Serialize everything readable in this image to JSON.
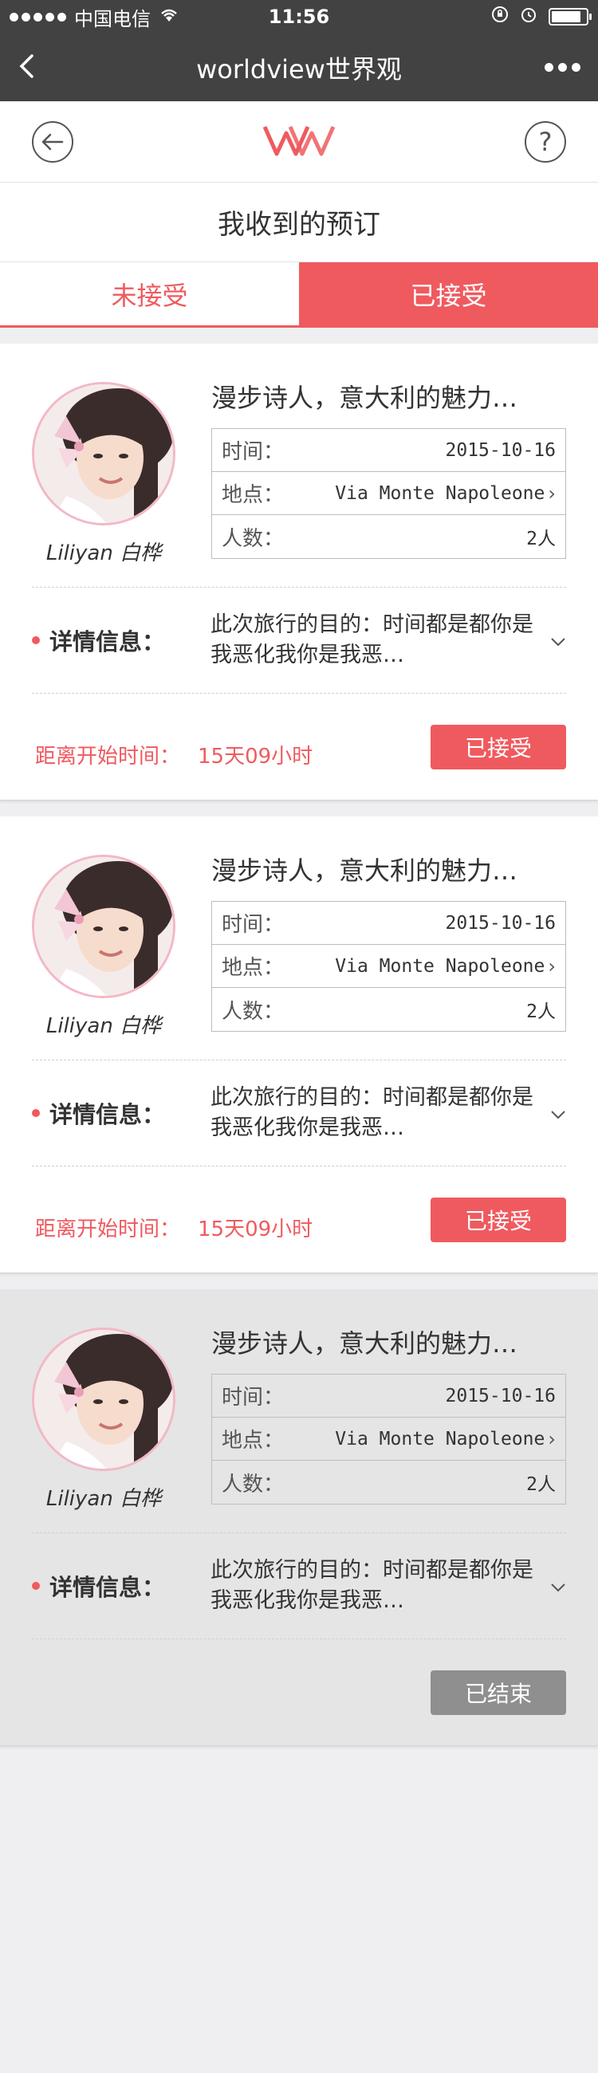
{
  "status_bar": {
    "carrier": "中国电信",
    "time": "11:56"
  },
  "nav": {
    "title": "worldview世界观"
  },
  "app_header": {
    "logo_text": "WV",
    "help_label": "?"
  },
  "section_title": "我收到的预订",
  "tabs": [
    {
      "label": "未接受",
      "active": false
    },
    {
      "label": "已接受",
      "active": true
    }
  ],
  "colors": {
    "accent": "#ef5a5f",
    "dark_bar": "#424242",
    "ended_bg": "#e5e5e5",
    "ended_button": "#8f8f8f"
  },
  "labels": {
    "time": "时间：",
    "place": "地点：",
    "people": "人数：",
    "detail": "详情信息：",
    "countdown": "距离开始时间："
  },
  "bookings": [
    {
      "host": "Liliyan 白桦",
      "title": "漫步诗人，意大利的魅力…",
      "date": "2015-10-16",
      "place": "Via Monte Napoleone",
      "people": "2人",
      "detail": "此次旅行的目的：时间都是都你是我恶化我你是我恶…",
      "countdown": "15天09小时",
      "status": "已接受"
    },
    {
      "host": "Liliyan 白桦",
      "title": "漫步诗人，意大利的魅力…",
      "date": "2015-10-16",
      "place": "Via Monte Napoleone",
      "people": "2人",
      "detail": "此次旅行的目的：时间都是都你是我恶化我你是我恶…",
      "countdown": "15天09小时",
      "status": "已接受"
    },
    {
      "host": "Liliyan 白桦",
      "title": "漫步诗人，意大利的魅力…",
      "date": "2015-10-16",
      "place": "Via Monte Napoleone",
      "people": "2人",
      "detail": "此次旅行的目的：时间都是都你是我恶化我你是我恶…",
      "countdown": "",
      "status": "已结束"
    }
  ]
}
